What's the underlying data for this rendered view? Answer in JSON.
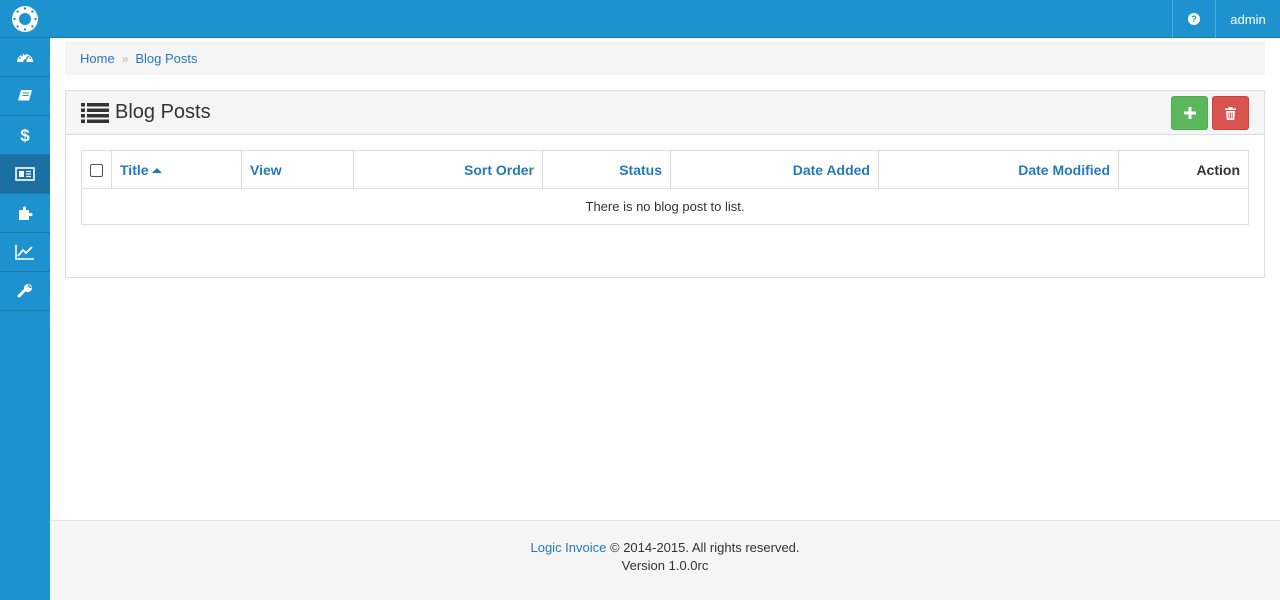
{
  "topbar": {
    "logo_icon": "aperture-logo-icon",
    "help_icon": "question-circle-icon",
    "user_label": "admin",
    "bg_color": "#1e91cf"
  },
  "sidebar": {
    "items": [
      {
        "icon": "dashboard-icon"
      },
      {
        "icon": "book-icon"
      },
      {
        "icon": "dollar-icon"
      },
      {
        "icon": "newspaper-icon",
        "active": true
      },
      {
        "icon": "puzzle-icon"
      },
      {
        "icon": "line-chart-icon"
      },
      {
        "icon": "wrench-icon"
      }
    ]
  },
  "breadcrumb": {
    "home": "Home",
    "separator": "»",
    "current": "Blog Posts"
  },
  "panel": {
    "title": "Blog Posts",
    "title_icon": "list-icon",
    "add_button_icon": "plus-icon",
    "delete_button_icon": "trash-icon",
    "add_color": "#5cb85c",
    "delete_color": "#d9534f"
  },
  "table": {
    "columns": {
      "title": "Title",
      "view": "View",
      "sort_order": "Sort Order",
      "status": "Status",
      "date_added": "Date Added",
      "date_modified": "Date Modified",
      "action": "Action"
    },
    "empty_message": "There is no blog post to list."
  },
  "footer": {
    "brand_link": "Logic Invoice",
    "copyright": "© 2014-2015. All rights reserved.",
    "version": "Version 1.0.0rc"
  }
}
